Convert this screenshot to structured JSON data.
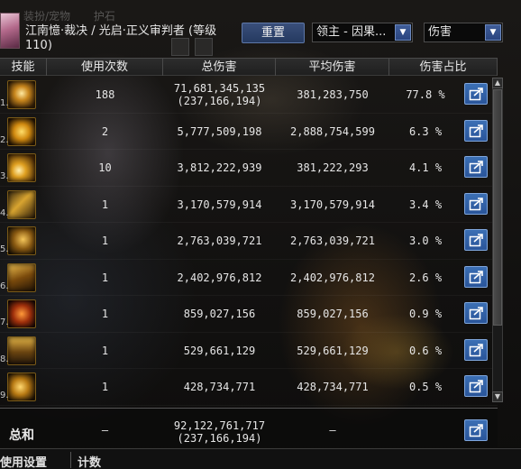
{
  "header": {
    "ghost_tabs": [
      "装扮/宠物",
      "护石"
    ],
    "character": "江南憶·裁决 / 光启·正义审判者 (等级110)",
    "reset_label": "重置",
    "target_select": "领主 - 因果...",
    "type_select": "伤害"
  },
  "table": {
    "columns": [
      "技能",
      "使用次数",
      "总伤害",
      "平均伤害",
      "伤害占比"
    ],
    "rows": [
      {
        "idx": "1.",
        "uses": "188",
        "total": "71,681,345,135",
        "total_sub": "(237,166,194)",
        "avg": "381,283,750",
        "pct": "77.8 %",
        "icon": "skill-1-icon"
      },
      {
        "idx": "2.",
        "uses": "2",
        "total": "5,777,509,198",
        "total_sub": "",
        "avg": "2,888,754,599",
        "pct": "6.3 %",
        "icon": "skill-2-icon"
      },
      {
        "idx": "3.",
        "uses": "10",
        "total": "3,812,222,939",
        "total_sub": "",
        "avg": "381,222,293",
        "pct": "4.1 %",
        "icon": "skill-3-icon"
      },
      {
        "idx": "4.",
        "uses": "1",
        "total": "3,170,579,914",
        "total_sub": "",
        "avg": "3,170,579,914",
        "pct": "3.4 %",
        "icon": "skill-4-icon"
      },
      {
        "idx": "5.",
        "uses": "1",
        "total": "2,763,039,721",
        "total_sub": "",
        "avg": "2,763,039,721",
        "pct": "3.0 %",
        "icon": "skill-5-icon"
      },
      {
        "idx": "6.",
        "uses": "1",
        "total": "2,402,976,812",
        "total_sub": "",
        "avg": "2,402,976,812",
        "pct": "2.6 %",
        "icon": "skill-6-icon"
      },
      {
        "idx": "7.",
        "uses": "1",
        "total": "859,027,156",
        "total_sub": "",
        "avg": "859,027,156",
        "pct": "0.9 %",
        "icon": "skill-7-icon"
      },
      {
        "idx": "8.",
        "uses": "1",
        "total": "529,661,129",
        "total_sub": "",
        "avg": "529,661,129",
        "pct": "0.6 %",
        "icon": "skill-8-icon"
      },
      {
        "idx": "9.",
        "uses": "1",
        "total": "428,734,771",
        "total_sub": "",
        "avg": "428,734,771",
        "pct": "0.5 %",
        "icon": "skill-9-icon"
      }
    ],
    "total": {
      "label": "总和",
      "uses": "–",
      "total": "92,122,761,717",
      "total_sub": "(237,166,194)",
      "avg": "–"
    }
  },
  "bottom_tabs": {
    "settings": "使用设置",
    "count": "计数"
  },
  "colors": {
    "share_button": "#2f62a8",
    "header_bg": "#262626",
    "icon_border": "#7a5a18"
  }
}
